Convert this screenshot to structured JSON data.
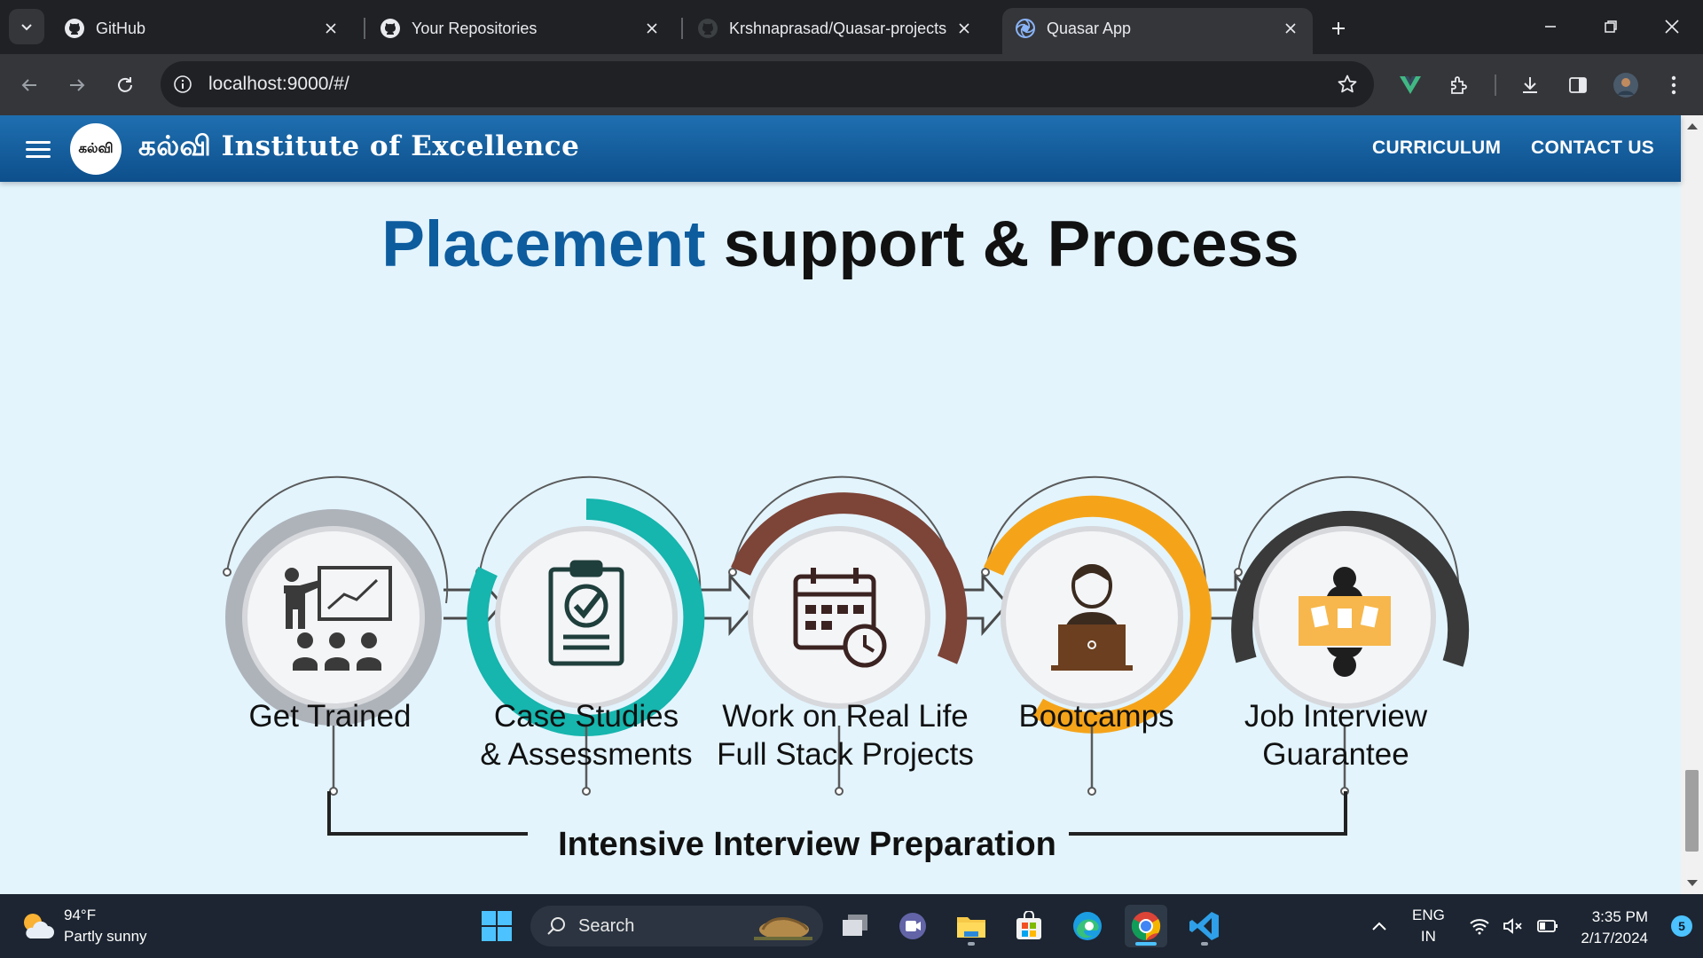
{
  "browser": {
    "tabs": [
      {
        "label": "GitHub",
        "icon": "github-icon",
        "active": false
      },
      {
        "label": "Your Repositories",
        "icon": "github-icon",
        "active": false
      },
      {
        "label": "Krshnaprasad/Quasar-projects",
        "icon": "github-icon",
        "active": false
      },
      {
        "label": "Quasar App",
        "icon": "quasar-icon",
        "active": true
      }
    ],
    "url": "localhost:9000/#/"
  },
  "app": {
    "logo_text": "கல்வி",
    "brand": "கல்வி Institute of Excellence",
    "nav": {
      "curriculum": "CURRICULUM",
      "contact": "CONTACT US"
    },
    "accent_color": "#0d5c9e"
  },
  "section": {
    "title_accent": "Placement",
    "title_rest": " support & Process",
    "steps": [
      {
        "label": "Get Trained",
        "icon": "presentation-icon",
        "ring_color": "#aeb3ba"
      },
      {
        "label": "Case Studies\n& Assessments",
        "icon": "clipboard-check-icon",
        "ring_color": "#16b5ad"
      },
      {
        "label": "Work on Real Life\nFull Stack Projects",
        "icon": "calendar-clock-icon",
        "ring_color": "#7d4438"
      },
      {
        "label": "Bootcamps",
        "icon": "laptop-user-icon",
        "ring_color": "#f5a41a"
      },
      {
        "label": "Job Interview\nGuarantee",
        "icon": "interview-icon",
        "ring_color": "#3a3a3a"
      }
    ],
    "footer_caption": "Intensive Interview Preparation"
  },
  "taskbar": {
    "weather_temp": "94°F",
    "weather_desc": "Partly sunny",
    "search_label": "Search",
    "lang_top": "ENG",
    "lang_bottom": "IN",
    "time": "3:35 PM",
    "date": "2/17/2024",
    "notifications": "5"
  }
}
